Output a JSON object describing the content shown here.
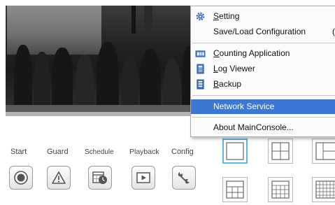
{
  "toolbar": {
    "buttons": [
      {
        "label": "Start",
        "icon": "record-icon"
      },
      {
        "label": "Guard",
        "icon": "warning-icon"
      },
      {
        "label": "Schedule",
        "icon": "calendar-clock-icon"
      },
      {
        "label": "Playback",
        "icon": "play-icon"
      },
      {
        "label": "Config",
        "icon": "wrench-icon"
      }
    ]
  },
  "layouts": {
    "selected": "single-view",
    "items": [
      "single-view",
      "2x2-grid",
      "3-split",
      "3x3-grid",
      "4x4-grid",
      "5x5-grid"
    ]
  },
  "context_menu": {
    "items": {
      "setting": {
        "prefix": "",
        "underline": "S",
        "rest": "etting",
        "icon": "gear-icon"
      },
      "save_load": {
        "label": "Save/Load Configuration",
        "extra": "("
      },
      "counting": {
        "prefix": "",
        "underline": "C",
        "rest": "ounting Application",
        "icon": "counting-app-icon"
      },
      "log_viewer": {
        "prefix": "",
        "underline": "L",
        "rest": "og Viewer",
        "icon": "log-document-icon"
      },
      "backup": {
        "prefix": "",
        "underline": "B",
        "rest": "ackup",
        "icon": "backup-icon"
      },
      "network_service": {
        "label": "Network Service"
      },
      "about": {
        "label": "About MainConsole..."
      }
    },
    "highlighted": "Network Service",
    "colors": {
      "highlight": "#3b78d6",
      "highlight_text": "#ffffff"
    }
  },
  "colors": {
    "selected_layout_border": "#5fb6de"
  }
}
